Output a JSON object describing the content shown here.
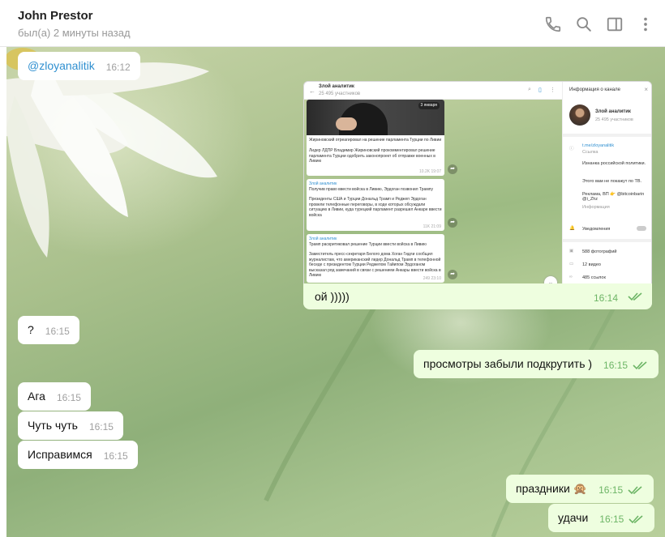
{
  "header": {
    "contact_name": "John Prestor",
    "status": "был(а) 2 минуты назад",
    "icons": [
      "phone-icon",
      "search-icon",
      "sidebar-toggle-icon",
      "more-vertical-icon"
    ]
  },
  "colors": {
    "incoming_bubble": "#ffffff",
    "outgoing_bubble": "#eefedf",
    "outgoing_time": "#6db566",
    "link": "#2f8fd0"
  },
  "messages": [
    {
      "direction": "in",
      "text": "@zloyanalitik",
      "time": "16:12"
    },
    {
      "direction": "out",
      "type": "screenshot",
      "caption": "ой )))))",
      "time": "16:14",
      "read": true
    },
    {
      "direction": "in",
      "text": "?",
      "time": "16:15"
    },
    {
      "direction": "out",
      "text": "просмотры забыли подкрутить )",
      "time": "16:15",
      "read": true
    },
    {
      "direction": "in",
      "text": "Ага",
      "time": "16:15"
    },
    {
      "direction": "in",
      "text": "Чуть чуть",
      "time": "16:15"
    },
    {
      "direction": "in",
      "text": "Исправимся",
      "time": "16:15"
    },
    {
      "direction": "out",
      "text": "праздники 🙊",
      "time": "16:15",
      "read": true
    },
    {
      "direction": "out",
      "text": "удачи",
      "time": "16:15",
      "read": true
    }
  ],
  "screenshot": {
    "channel_title": "Злой аналитик",
    "channel_subs": "25 495 участников",
    "panel_title": "Информация о канале",
    "panel_link": "t.me/zloyanalitik",
    "panel_link_label": "Ссылка",
    "panel_desc1": "Изнанка российской политики.",
    "panel_desc2": "Этого вам не покажут по ТВ.",
    "panel_ads": "Реклама, ВП 👉 @bitcoinbarin @i_Zhz",
    "panel_info_label": "Информация",
    "panel_notifications": "Уведомления",
    "panel_photos": "588 фотографий",
    "panel_videos": "12 видео",
    "panel_links": "485 ссылок",
    "date_badge": "3 января",
    "post1_title": "Жириновский отреагировал на решение парламента Турции по Ливии",
    "post1_body": "Лидер ЛДПР Владимир Жириновский прокомментировал решение парламента Турции одобрить законопроект об отправке военных в Ливию",
    "post1_meta": "10.2K  19:07",
    "post2_channel": "Злой аналитик",
    "post2_title": "Получив право ввести войска в Ливию, Эрдоган позвонил Трампу",
    "post2_body": "Президенты США и Турции Дональд Трамп и Реджеп Эрдоган провели телефонные переговоры, в ходе которых обсуждали ситуацию в Ливии, куда турецкий парламент разрешил Анкаре ввести войска",
    "post2_meta": "11K  21:09",
    "post3_channel": "Злой аналитик",
    "post3_title": "Трамп раскритиковал решение Турции ввести войска в Ливию",
    "post3_body": "Заместитель пресс-секретаря Белого дома Хоган Гидли сообщил журналистам, что американский лидер Дональд Трамп в телефонной беседе с президентом Турции Реджепом Тайипом Эрдоганом высказал ряд замечаний в связи с решением Анкары ввести войска в Ливию",
    "post3_meta": "249  23:10"
  }
}
